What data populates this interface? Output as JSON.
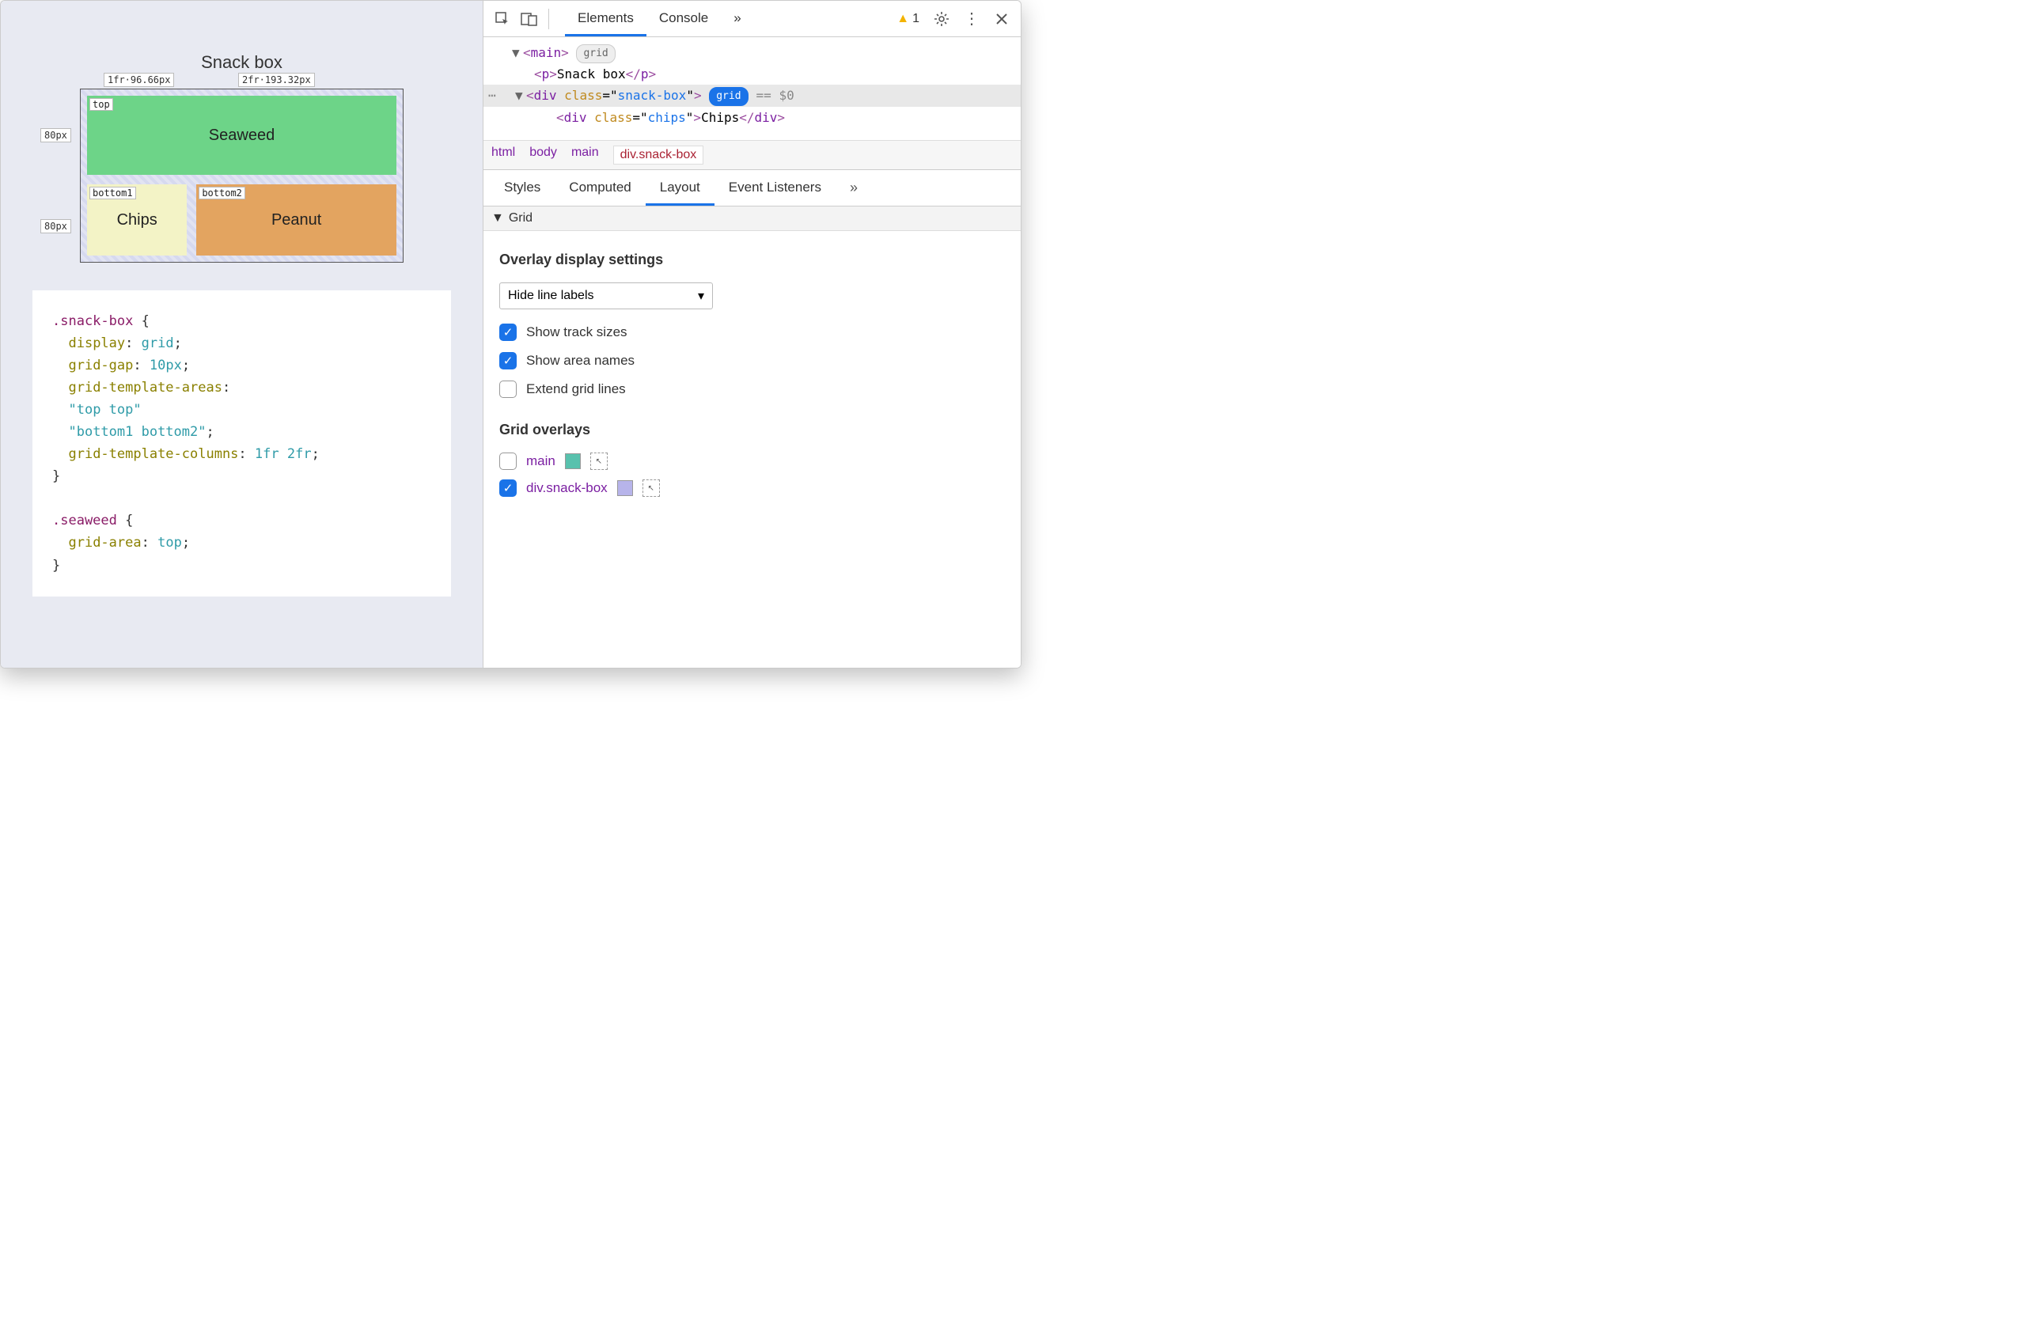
{
  "preview": {
    "title": "Snack box",
    "col_labels": [
      "1fr·96.66px",
      "2fr·193.32px"
    ],
    "row_labels": [
      "80px",
      "80px"
    ],
    "areas": {
      "top": "top",
      "bottom1": "bottom1",
      "bottom2": "bottom2"
    },
    "cells": {
      "seaweed": "Seaweed",
      "chips": "Chips",
      "peanut": "Peanut"
    }
  },
  "code": {
    "sel1": ".snack-box",
    "l1p": "display",
    "l1v": "grid",
    "l2p": "grid-gap",
    "l2v": "10px",
    "l3p": "grid-template-areas",
    "l3v1": "\"top top\"",
    "l3v2": "\"bottom1 bottom2\"",
    "l4p": "grid-template-columns",
    "l4v": "1fr 2fr",
    "sel2": ".seaweed",
    "l5p": "grid-area",
    "l5v": "top"
  },
  "toolbar": {
    "tabs": {
      "elements": "Elements",
      "console": "Console"
    },
    "more": "»",
    "warn_count": "1"
  },
  "dom": {
    "main_tag": "main",
    "main_badge": "grid",
    "p_text": "Snack box",
    "div1_class": "snack-box",
    "div1_badge": "grid",
    "eq": "== $0",
    "child_class": "chips",
    "child_text": "Chips"
  },
  "breadcrumb": [
    "html",
    "body",
    "main",
    "div.snack-box"
  ],
  "lower_tabs": [
    "Styles",
    "Computed",
    "Layout",
    "Event Listeners"
  ],
  "lower_active": 2,
  "lower_more": "»",
  "grid_section": {
    "title": "Grid",
    "overlay_heading": "Overlay display settings",
    "select_value": "Hide line labels",
    "opts": {
      "track_sizes": "Show track sizes",
      "area_names": "Show area names",
      "extend_lines": "Extend grid lines"
    },
    "overlays_heading": "Grid overlays",
    "overlays": [
      {
        "name": "main",
        "color": "#58c1ad",
        "checked": false
      },
      {
        "name": "div.snack-box",
        "color": "#b7b4ea",
        "checked": true
      }
    ]
  }
}
